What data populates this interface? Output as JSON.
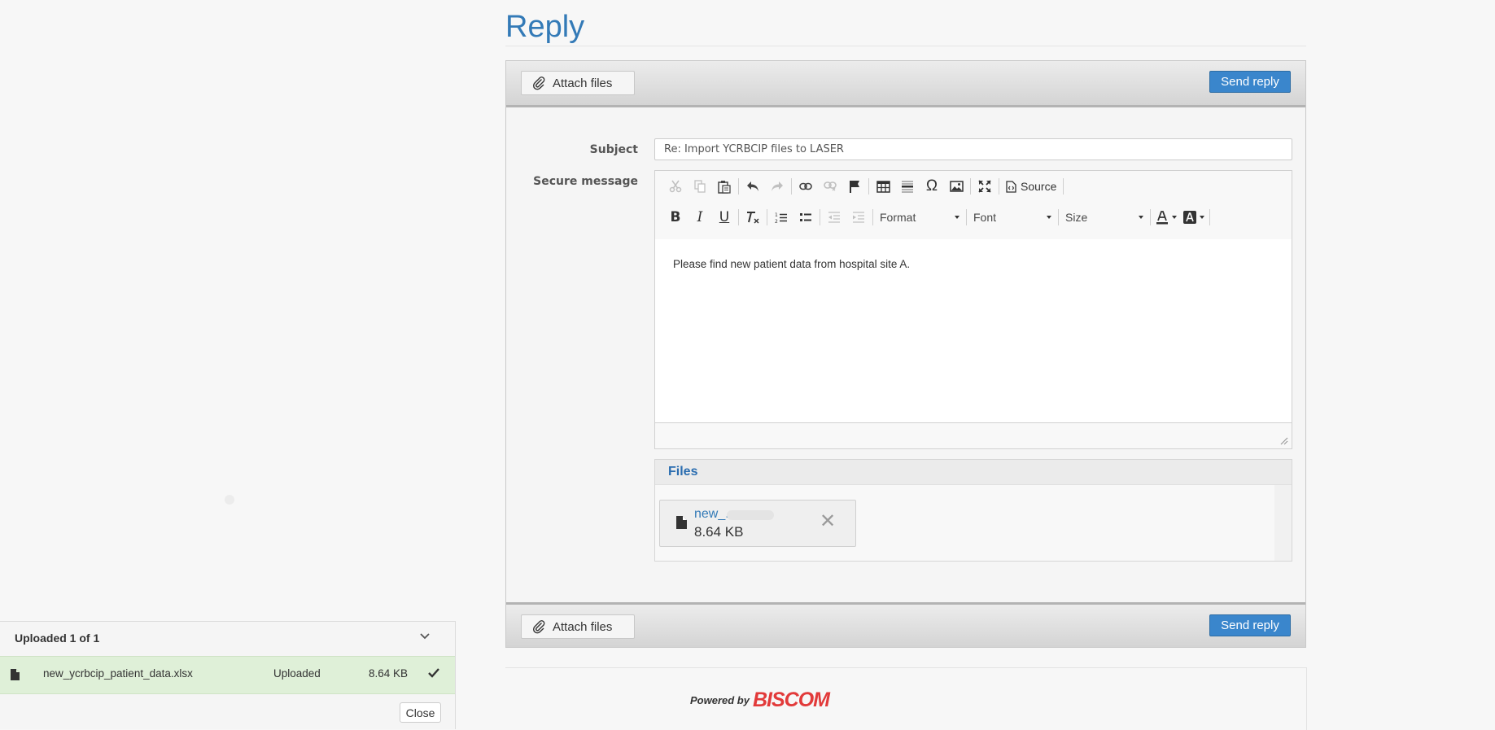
{
  "page": {
    "title": "Reply"
  },
  "toolbar": {
    "attach_label": "Attach files",
    "send_label": "Send reply"
  },
  "form": {
    "subject_label": "Subject",
    "subject_value": "Re: Import YCRBCIP files to LASER",
    "message_label": "Secure message"
  },
  "editor": {
    "source_label": "Source",
    "format_label": "Format",
    "font_label": "Font",
    "size_label": "Size",
    "body_text": "Please find new patient data from hospital site A.",
    "icons": [
      "cut-icon",
      "copy-icon",
      "paste-icon",
      "undo-icon",
      "redo-icon",
      "link-icon",
      "unlink-icon",
      "anchor-icon",
      "table-icon",
      "horizontal-line-icon",
      "special-char-icon",
      "image-icon",
      "maximize-icon",
      "source-icon",
      "bold-icon",
      "italic-icon",
      "underline-icon",
      "remove-format-icon",
      "numbered-list-icon",
      "bulleted-list-icon",
      "outdent-icon",
      "indent-icon",
      "text-color-icon",
      "background-color-icon"
    ]
  },
  "files": {
    "heading": "Files",
    "items": [
      {
        "name": "new_...",
        "size": "8.64 KB"
      }
    ]
  },
  "footer": {
    "powered_by": "Powered by",
    "brand": "BISCOM"
  },
  "upload": {
    "status_heading": "Uploaded 1 of 1",
    "items": [
      {
        "name": "new_ycrbcip_patient_data.xlsx",
        "status": "Uploaded",
        "size": "8.64 KB"
      }
    ],
    "close_label": "Close"
  },
  "colors": {
    "accent": "#337ab7",
    "send_button": "#3a86cc",
    "upload_success_bg": "#dff0d8",
    "brand": "#e23a3a"
  }
}
